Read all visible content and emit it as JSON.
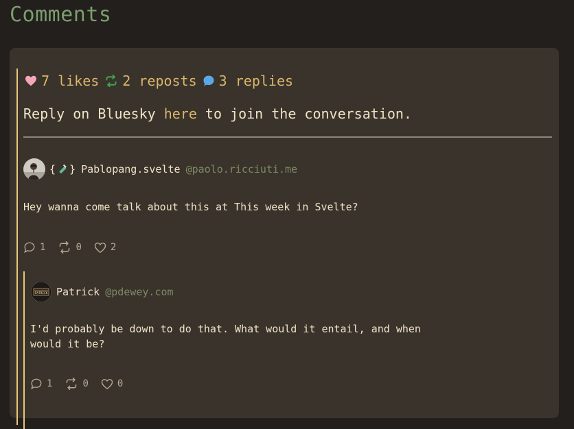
{
  "page": {
    "title": "Comments"
  },
  "stats": {
    "likes": "7 likes",
    "reposts": "2 reposts",
    "replies": "3 replies"
  },
  "cta": {
    "before": "Reply on Bluesky ",
    "link": "here",
    "after": " to join the conversation."
  },
  "post": {
    "author_prefix_open": "{",
    "author_prefix_close": "}",
    "author_name": "Pablopang.svelte",
    "handle": "@paolo.ricciuti.me",
    "text": "Hey wanna come talk about this at This week in Svelte?",
    "replies": "1",
    "reposts": "0",
    "likes": "2"
  },
  "reply": {
    "author_name": "Patrick",
    "handle": "@pdewey.com",
    "text_line1": "I'd probably be down to do that. What would it entail, and when",
    "text_line2": "would it be?",
    "replies": "1",
    "reposts": "0",
    "likes": "0",
    "avatar_text": "PATRICK"
  },
  "colors": {
    "background": "#221f1c",
    "card": "#3a332c",
    "title": "#7c9e6e",
    "accent": "#d9b66a",
    "thread_line": "#e8c97a",
    "handle": "#7c8a62",
    "heart": "#f4a7b9",
    "repost": "#3fa34d",
    "reply_bubble": "#5aa9e6"
  },
  "icons": [
    "heart-icon",
    "repost-icon",
    "speech-bubble-icon",
    "syringe-icon",
    "comment-icon",
    "like-icon"
  ]
}
